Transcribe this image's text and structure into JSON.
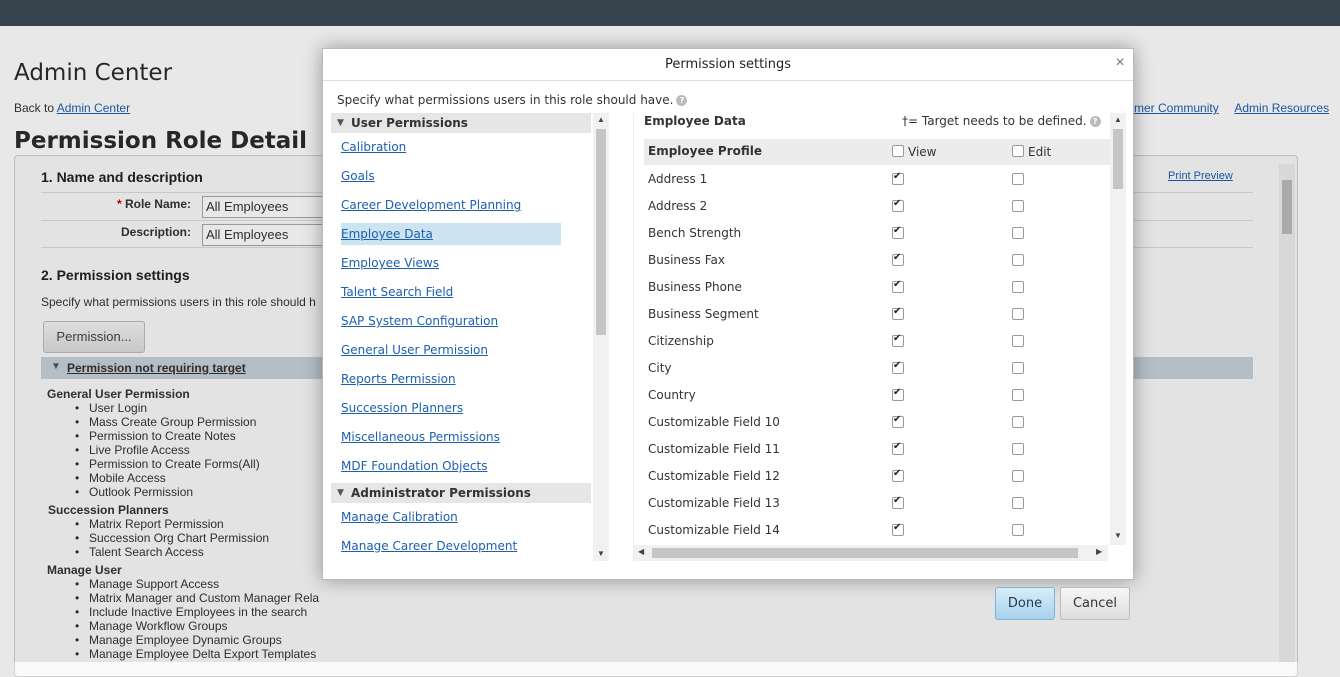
{
  "background": {
    "admin_center_title": "Admin Center",
    "back_prefix": "Back to",
    "back_link": "Admin Center",
    "right_links": [
      "tomer Community",
      "Admin Resources"
    ],
    "page_title": "Permission Role Detail",
    "section1": "1. Name and description",
    "role_name_label": "Role Name:",
    "role_name_value": "All Employees",
    "description_label": "Description:",
    "description_value": "All Employees",
    "section2": "2. Permission settings",
    "section2_desc": "Specify what permissions users in this role should h",
    "permission_button": "Permission...",
    "print_preview": "Print Preview",
    "band_title": "Permission not requiring target",
    "groups": [
      {
        "name": "General User Permission",
        "items": [
          "User Login",
          "Mass Create Group Permission",
          "Permission to Create Notes",
          "Live Profile Access",
          "Permission to Create Forms(All)",
          "Mobile Access",
          "Outlook Permission"
        ]
      },
      {
        "name": "Succession Planners",
        "items": [
          "Matrix Report Permission",
          "Succession Org Chart Permission",
          "Talent Search Access"
        ]
      },
      {
        "name": "Manage User",
        "items": [
          "Manage Support Access",
          "Matrix Manager and Custom Manager Rela",
          "Include Inactive Employees in the search",
          "Manage Workflow Groups",
          "Manage Employee Dynamic Groups",
          "Manage Employee Delta Export Templates"
        ]
      }
    ]
  },
  "modal": {
    "title": "Permission settings",
    "close": "×",
    "instruction": "Specify what permissions users in this role should have.",
    "help": "?",
    "user_permissions_header": "User Permissions",
    "user_permission_links": [
      "Calibration",
      "Goals",
      "Career Development Planning",
      "Employee Data",
      "Employee Views",
      "Talent Search Field",
      "SAP System Configuration",
      "General User Permission",
      "Reports Permission",
      "Succession Planners",
      "Miscellaneous Permissions",
      "MDF Foundation Objects"
    ],
    "selected_index": 3,
    "admin_permissions_header": "Administrator Permissions",
    "admin_permission_links": [
      "Manage Calibration",
      "Manage Career Development"
    ],
    "right_header": "Employee Data",
    "target_note": "†= Target needs to be defined.",
    "section_title": "Employee Profile",
    "view_label": "View",
    "edit_label": "Edit",
    "rows": [
      {
        "name": "Address 1",
        "view": true,
        "edit": false
      },
      {
        "name": "Address 2",
        "view": true,
        "edit": false
      },
      {
        "name": "Bench Strength",
        "view": true,
        "edit": false
      },
      {
        "name": "Business Fax",
        "view": true,
        "edit": false
      },
      {
        "name": "Business Phone",
        "view": true,
        "edit": false
      },
      {
        "name": "Business Segment",
        "view": true,
        "edit": false
      },
      {
        "name": "Citizenship",
        "view": true,
        "edit": false
      },
      {
        "name": "City",
        "view": true,
        "edit": false
      },
      {
        "name": "Country",
        "view": true,
        "edit": false
      },
      {
        "name": "Customizable Field 10",
        "view": true,
        "edit": false
      },
      {
        "name": "Customizable Field 11",
        "view": true,
        "edit": false
      },
      {
        "name": "Customizable Field 12",
        "view": true,
        "edit": false
      },
      {
        "name": "Customizable Field 13",
        "view": true,
        "edit": false
      },
      {
        "name": "Customizable Field 14",
        "view": true,
        "edit": false
      }
    ],
    "done": "Done",
    "cancel": "Cancel"
  }
}
